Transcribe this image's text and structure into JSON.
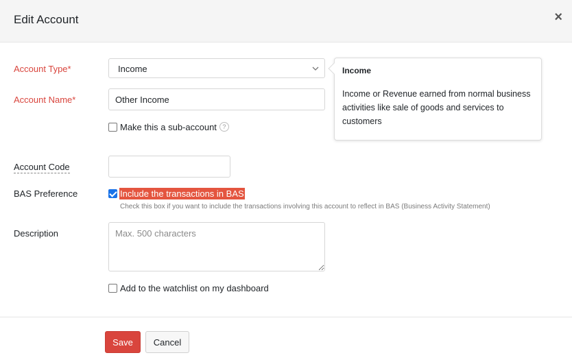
{
  "header": {
    "title": "Edit Account",
    "close_label": "×"
  },
  "form": {
    "account_type": {
      "label": "Account Type*",
      "value": "Income"
    },
    "account_name": {
      "label": "Account Name*",
      "value": "Other Income"
    },
    "sub_account": {
      "label": "Make this a sub-account",
      "help": "?",
      "checked": false
    },
    "account_code": {
      "label": "Account Code",
      "value": ""
    },
    "bas_preference": {
      "label": "BAS Preference",
      "checkbox_label": "Include the transactions in BAS",
      "checked": true,
      "hint": "Check this box if you want to include the transactions involving this account to reflect in BAS (Business Activity Statement)"
    },
    "description": {
      "label": "Description",
      "placeholder": "Max. 500 characters",
      "value": ""
    },
    "watchlist": {
      "label": "Add to the watchlist on my dashboard",
      "checked": false
    }
  },
  "tooltip": {
    "title": "Income",
    "body": "Income or Revenue earned from normal business activities like sale of goods and services to customers"
  },
  "footer": {
    "save_label": "Save",
    "cancel_label": "Cancel"
  },
  "colors": {
    "accent": "#d9453d",
    "highlight": "#e4553f",
    "checkbox": "#1a73e8"
  }
}
